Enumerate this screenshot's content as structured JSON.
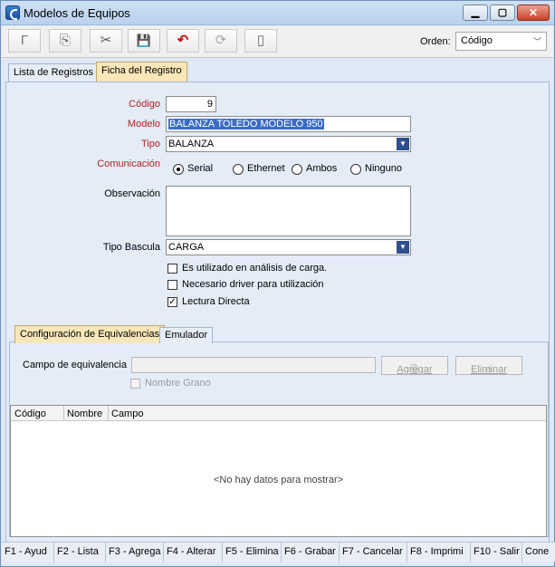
{
  "window": {
    "title": "Modelos de Equipos",
    "min_label": "▁",
    "max_label": "▢",
    "close_label": "✕"
  },
  "toolbar": {
    "buttons": [
      {
        "icon": "new-icon",
        "glyph": "Γ"
      },
      {
        "icon": "copy-icon",
        "glyph": "⎘"
      },
      {
        "icon": "delete-icon",
        "glyph": "✂"
      },
      {
        "icon": "save-icon",
        "glyph": "💾"
      },
      {
        "icon": "undo-icon",
        "glyph": "↶"
      },
      {
        "icon": "refresh-icon",
        "glyph": "⟳"
      },
      {
        "icon": "exit-icon",
        "glyph": "▯"
      }
    ],
    "order_label": "Orden:",
    "order_value": "Código"
  },
  "tabs": {
    "list": "Lista de Registros",
    "record": "Ficha del Registro"
  },
  "form": {
    "codigo_label": "Código",
    "codigo_value": "9",
    "modelo_label": "Modelo",
    "modelo_value": "BALANZA TOLEDO MODELO 950",
    "tipo_label": "Tipo",
    "tipo_value": "BALANZA",
    "comunicacion_label": "Comunicación",
    "comunicacion_options": [
      "Serial",
      "Ethernet",
      "Ambos",
      "Ninguno"
    ],
    "comunicacion_selected": "Serial",
    "observacion_label": "Observación",
    "observacion_value": "",
    "tipo_bascula_label": "Tipo Bascula",
    "tipo_bascula_value": "CARGA",
    "check_analisis": "Es utilizado en análisis de carga.",
    "check_driver": "Necesario driver para utilización",
    "check_lectura": "Lectura Directa"
  },
  "subtabs": {
    "equivalencias": "Configuración de Equivalencias",
    "emulador": "Emulador"
  },
  "equivalencias": {
    "campo_label": "Campo de equivalencia",
    "campo_value": "",
    "agregar": "Agregar",
    "eliminar": "Eliminar",
    "nombre_grano": "Nombre Grano"
  },
  "grid": {
    "columns": [
      "Código",
      "Nombre",
      "Campo"
    ],
    "empty_text": "<No hay datos para mostrar>"
  },
  "fkeys": [
    "F1 - Ayud",
    "F2 - Lista",
    "F3 - Agrega",
    "F4 - Alterar",
    "F5 - Elimina",
    "F6 - Grabar",
    "F7 - Cancelar",
    "F8 - Imprimi",
    "F10 - Salir",
    "Cone"
  ]
}
